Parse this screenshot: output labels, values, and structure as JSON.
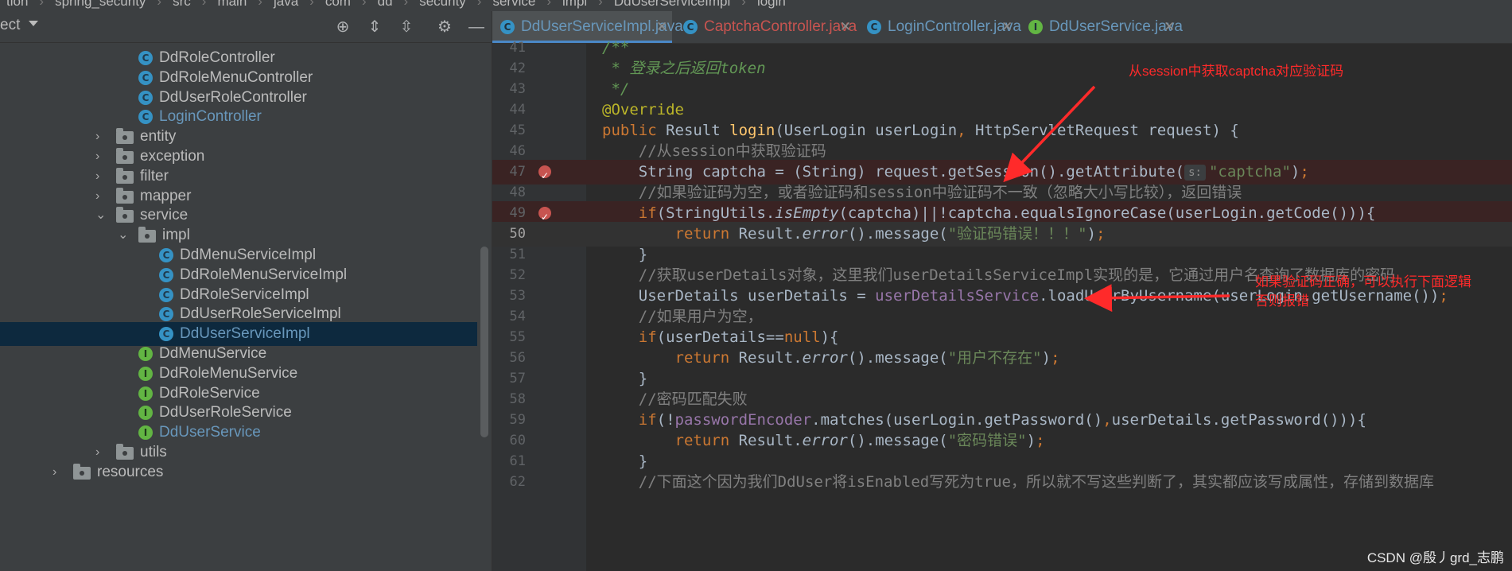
{
  "breadcrumb": [
    "tion",
    "spring_security",
    "src",
    "main",
    "java",
    "com",
    "dd",
    "security",
    "service",
    "impl",
    "DdUserServiceImpl",
    "login"
  ],
  "project_panel": {
    "title": "ect",
    "tree": [
      {
        "label": "DdRoleController",
        "kind": "class",
        "indent": 174
      },
      {
        "label": "DdRoleMenuController",
        "kind": "class",
        "indent": 174
      },
      {
        "label": "DdUserRoleController",
        "kind": "class",
        "indent": 174
      },
      {
        "label": "LoginController",
        "kind": "class",
        "indent": 174,
        "vcs": "modified"
      },
      {
        "label": "entity",
        "kind": "package",
        "indent": 146,
        "arrow": "›"
      },
      {
        "label": "exception",
        "kind": "package",
        "indent": 146,
        "arrow": "›"
      },
      {
        "label": "filter",
        "kind": "package",
        "indent": 146,
        "arrow": "›"
      },
      {
        "label": "mapper",
        "kind": "package",
        "indent": 146,
        "arrow": "›"
      },
      {
        "label": "service",
        "kind": "package",
        "indent": 146,
        "arrow": "⌄"
      },
      {
        "label": "impl",
        "kind": "package",
        "indent": 174,
        "arrow": "⌄"
      },
      {
        "label": "DdMenuServiceImpl",
        "kind": "class",
        "indent": 200
      },
      {
        "label": "DdRoleMenuServiceImpl",
        "kind": "class",
        "indent": 200
      },
      {
        "label": "DdRoleServiceImpl",
        "kind": "class",
        "indent": 200
      },
      {
        "label": "DdUserRoleServiceImpl",
        "kind": "class",
        "indent": 200
      },
      {
        "label": "DdUserServiceImpl",
        "kind": "class",
        "indent": 200,
        "selected": true,
        "vcs": "modified"
      },
      {
        "label": "DdMenuService",
        "kind": "interface",
        "indent": 174
      },
      {
        "label": "DdRoleMenuService",
        "kind": "interface",
        "indent": 174
      },
      {
        "label": "DdRoleService",
        "kind": "interface",
        "indent": 174
      },
      {
        "label": "DdUserRoleService",
        "kind": "interface",
        "indent": 174
      },
      {
        "label": "DdUserService",
        "kind": "interface",
        "indent": 174,
        "vcs": "modified"
      },
      {
        "label": "utils",
        "kind": "package",
        "indent": 146,
        "arrow": "›"
      },
      {
        "label": "resources",
        "kind": "package",
        "indent": 92,
        "arrow": "›"
      }
    ]
  },
  "tabs": [
    {
      "label": "DdUserServiceImpl.java",
      "icon": "C",
      "active": true,
      "color": "#6897bb"
    },
    {
      "label": "CaptchaController.java",
      "icon": "C",
      "color": "#c75450"
    },
    {
      "label": "LoginController.java",
      "icon": "C",
      "color": "#6897bb"
    },
    {
      "label": "DdUserService.java",
      "icon": "I",
      "color": "#6897bb"
    }
  ],
  "code_lines": [
    {
      "n": "41",
      "html": "<span class='doc'>/**</span>"
    },
    {
      "n": "42",
      "html": "<span class='doc'> * 登录之后返回token</span>"
    },
    {
      "n": "43",
      "html": "<span class='doc'> */</span>"
    },
    {
      "n": "44",
      "html": "<span class='a'>@Override</span>"
    },
    {
      "n": "45",
      "html": "<span class='k'>public </span>Result <span class='m'>login</span>(UserLogin userLogin<span class='k'>, </span>HttpServletRequest request) {"
    },
    {
      "n": "46",
      "html": "    <span class='c'>//从session中获取验证码</span>"
    },
    {
      "n": "47",
      "html": "    String captcha = (String) request.getSession().getAttribute(<span class='hint'>s:</span><span class='s'>\"captcha\"</span>)<span class='k'>;</span>",
      "bp": true
    },
    {
      "n": "48",
      "html": "    <span class='c'>//如果验证码为空，或者验证码和session中验证码不一致（忽略大小写比较），返回错误</span>"
    },
    {
      "n": "49",
      "html": "    <span class='k'>if</span>(StringUtils.<span class='it'>isEmpty</span>(captcha)||!captcha.equalsIgnoreCase(userLogin.getCode())){",
      "bp": true
    },
    {
      "n": "50",
      "html": "        <span class='k'>return </span>Result.<span class='it'>error</span>().message(<span class='s'>\"验证码错误！！！\"</span>)<span class='k'>;</span>",
      "current": true
    },
    {
      "n": "51",
      "html": "    }"
    },
    {
      "n": "52",
      "html": "    <span class='c'>//获取userDetails对象，这里我们userDetailsServiceImpl实现的是，它通过用户名查询了数据库的密码</span>"
    },
    {
      "n": "53",
      "html": "    UserDetails userDetails = <span class='f'>userDetailsService</span>.loadUserByUsername(userLogin.getUsername())<span class='k'>;</span>"
    },
    {
      "n": "54",
      "html": "    <span class='c'>//如果用户为空，</span>"
    },
    {
      "n": "55",
      "html": "    <span class='k'>if</span>(userDetails==<span class='k'>null</span>){"
    },
    {
      "n": "56",
      "html": "        <span class='k'>return </span>Result.<span class='it'>error</span>().message(<span class='s'>\"用户不存在\"</span>)<span class='k'>;</span>"
    },
    {
      "n": "57",
      "html": "    }"
    },
    {
      "n": "58",
      "html": "    <span class='c'>//密码匹配失败</span>"
    },
    {
      "n": "59",
      "html": "    <span class='k'>if</span>(!<span class='f'>passwordEncoder</span>.matches(userLogin.getPassword()<span class='k'>,</span>userDetails.getPassword())){"
    },
    {
      "n": "60",
      "html": "        <span class='k'>return </span>Result.<span class='it'>error</span>().message(<span class='s'>\"密码错误\"</span>)<span class='k'>;</span>"
    },
    {
      "n": "61",
      "html": "    }"
    },
    {
      "n": "62",
      "html": "    <span class='c'>//下面这个因为我们DdUser将isEnabled写死为true，所以就不写这些判断了，其实都应该写成属性，存储到数据库</span>"
    }
  ],
  "annotations": {
    "top": "从session中获取captcha对应验证码",
    "right": "如果验证码正确，可以执行下面逻辑\n否则报错"
  },
  "watermark": "CSDN @殷丿grd_志鹏",
  "colors": {
    "accent": "#4a88c7",
    "annotation": "#ff2a2a"
  }
}
